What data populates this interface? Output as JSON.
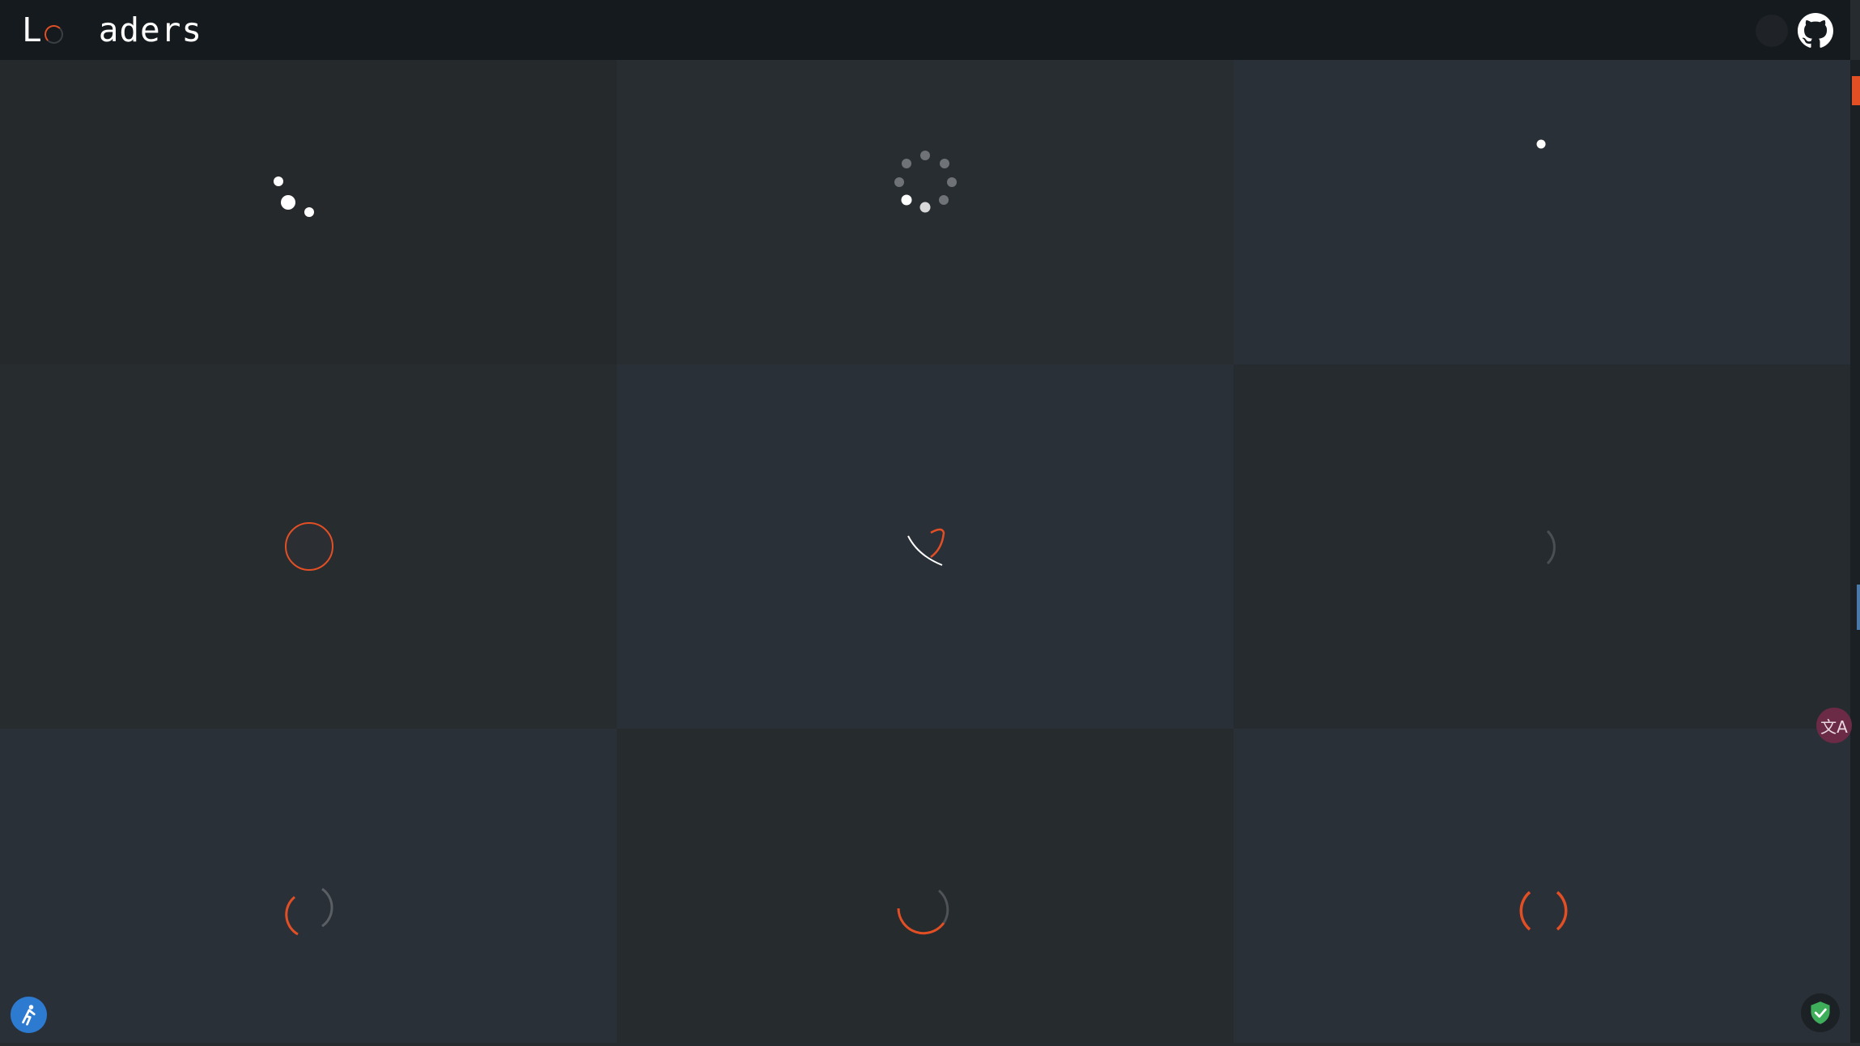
{
  "header": {
    "logo_first": "L",
    "logo_rest": "aders"
  },
  "icons": {
    "theme_toggle": "circle",
    "github": "github-icon",
    "translate": "translate-icon",
    "accessibility": "accessibility-icon",
    "shield": "shield-check-icon"
  },
  "colors": {
    "accent": "#e34f25",
    "background": "#262b30",
    "header": "#141a1e",
    "dot": "#ffffff"
  },
  "translate_label": "文A",
  "loaders": [
    {
      "id": 1,
      "kind": "bouncing-dots"
    },
    {
      "id": 2,
      "kind": "dot-ring"
    },
    {
      "id": 3,
      "kind": "single-dot"
    },
    {
      "id": 4,
      "kind": "ring"
    },
    {
      "id": 5,
      "kind": "swoosh"
    },
    {
      "id": 6,
      "kind": "faint-arc"
    },
    {
      "id": 7,
      "kind": "dual-arc"
    },
    {
      "id": 8,
      "kind": "spinner-arc"
    },
    {
      "id": 9,
      "kind": "bracket-arcs"
    }
  ]
}
